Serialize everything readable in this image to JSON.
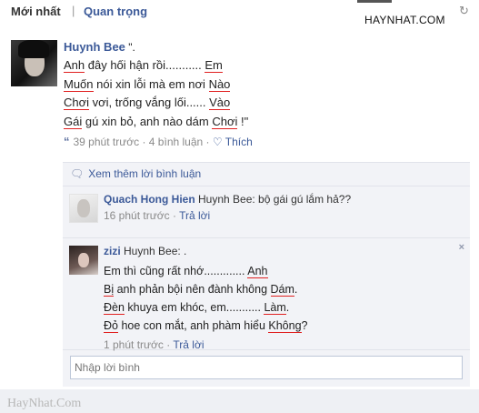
{
  "tabs": {
    "newest": "Mới nhất",
    "separator": "|",
    "important": "Quan trọng"
  },
  "watermark_top": "HAYNHAT.COM",
  "post": {
    "author": "Huynh Bee",
    "author_suffix": " \".",
    "lines": [
      {
        "parts": [
          {
            "t": "Anh",
            "u": true
          },
          {
            "t": " đây hối hận rồi........... ",
            "u": false
          },
          {
            "t": "Em",
            "u": true
          }
        ]
      },
      {
        "parts": [
          {
            "t": "Muốn",
            "u": true
          },
          {
            "t": " nói xin lỗi mà em nơi ",
            "u": false
          },
          {
            "t": "Nào",
            "u": true
          }
        ]
      },
      {
        "parts": [
          {
            "t": "Chơi",
            "u": true
          },
          {
            "t": " vơi, trống vắng lối...... ",
            "u": false
          },
          {
            "t": "Vào",
            "u": true
          }
        ]
      },
      {
        "parts": [
          {
            "t": "Gái",
            "u": true
          },
          {
            "t": " gú xin bỏ, anh nào dám ",
            "u": false
          },
          {
            "t": "Chơi",
            "u": true
          },
          {
            "t": " !\"",
            "u": false
          }
        ]
      }
    ],
    "time": "39 phút trước",
    "dot": "·",
    "comments": "4 bình luận",
    "like": "Thích"
  },
  "replies": {
    "more": "Xem thêm lời bình luận",
    "comment1": {
      "name": "Quach Hong Hien",
      "text": " Huynh Bee: bộ gái gú lắm hả??",
      "time": "16 phút trước",
      "dot": "·",
      "reply": "Trả lời"
    },
    "comment2": {
      "name": "zizi",
      "text": " Huynh Bee: .",
      "lines": [
        {
          "parts": [
            {
              "t": "Em thì cũng rất nhớ............. ",
              "u": false
            },
            {
              "t": "Anh",
              "u": true
            }
          ]
        },
        {
          "parts": [
            {
              "t": "Bị",
              "u": true
            },
            {
              "t": " anh phản bội nên đành không ",
              "u": false
            },
            {
              "t": "Dám",
              "u": true
            },
            {
              "t": ".",
              "u": false
            }
          ]
        },
        {
          "parts": [
            {
              "t": "Đèn",
              "u": true
            },
            {
              "t": " khuya em khóc, em........... ",
              "u": false
            },
            {
              "t": "Làm",
              "u": true
            },
            {
              "t": ".",
              "u": false
            }
          ]
        },
        {
          "parts": [
            {
              "t": "Đỏ",
              "u": true
            },
            {
              "t": " hoe con mắt, anh phàm hiểu ",
              "u": false
            },
            {
              "t": "Không",
              "u": true
            },
            {
              "t": "?",
              "u": false
            }
          ]
        }
      ],
      "time": "1 phút trước",
      "dot": "·",
      "reply": "Trả lời",
      "close": "×"
    },
    "write_placeholder": "Nhập lời bình"
  },
  "watermark_bottom": "HayNhat.Com",
  "colors": {
    "link": "#3b5998",
    "underline": "#e02020",
    "panel": "#f2f3f7"
  }
}
